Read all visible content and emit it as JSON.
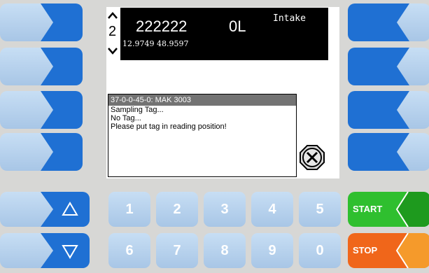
{
  "display": {
    "step": "2",
    "tag_id": "222222",
    "volume": "0L",
    "mode": "Intake",
    "coordinates": "12.9749  48.9597"
  },
  "message": {
    "title": "37-0-0-45-0: MAK 3003",
    "lines": [
      "Sampling Tag...",
      "No Tag...",
      "Please put tag in reading position!"
    ]
  },
  "keypad": {
    "row1": [
      "1",
      "2",
      "3",
      "4",
      "5"
    ],
    "row2": [
      "6",
      "7",
      "8",
      "9",
      "0"
    ]
  },
  "actions": {
    "start_label": "START",
    "stop_label": "STOP"
  },
  "colors": {
    "button_light": "#bdd6f0",
    "button_dark": "#1e6fd4",
    "start_green": "#2db22d",
    "stop_orange": "#ef6a12"
  }
}
